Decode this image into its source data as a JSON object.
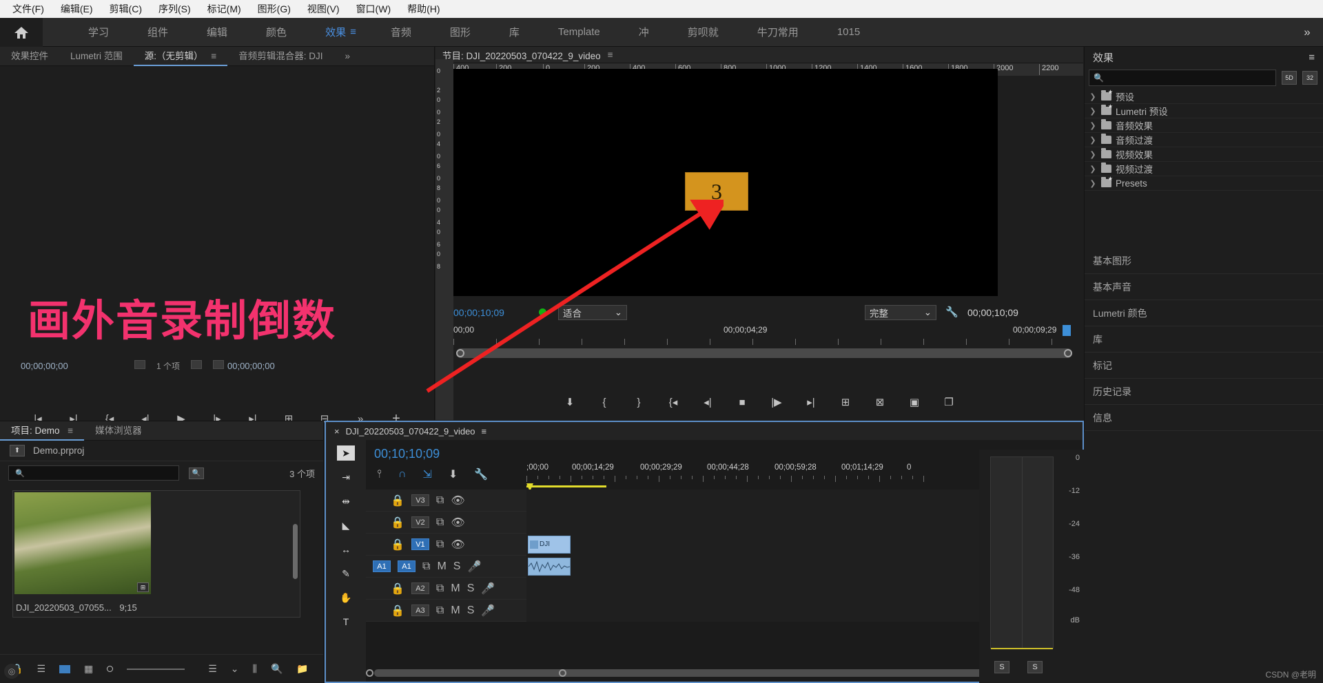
{
  "menubar": [
    {
      "label": "文件(F)"
    },
    {
      "label": "编辑(E)"
    },
    {
      "label": "剪辑(C)"
    },
    {
      "label": "序列(S)"
    },
    {
      "label": "标记(M)"
    },
    {
      "label": "图形(G)"
    },
    {
      "label": "视图(V)"
    },
    {
      "label": "窗口(W)"
    },
    {
      "label": "帮助(H)"
    }
  ],
  "workspace": {
    "home_icon": "home-icon",
    "tabs": [
      {
        "label": "学习",
        "active": false
      },
      {
        "label": "组件",
        "active": false
      },
      {
        "label": "编辑",
        "active": false
      },
      {
        "label": "颜色",
        "active": false
      },
      {
        "label": "效果",
        "active": true
      },
      {
        "label": "音频",
        "active": false
      },
      {
        "label": "图形",
        "active": false
      },
      {
        "label": "库",
        "active": false
      },
      {
        "label": "Template",
        "active": false
      },
      {
        "label": "冲",
        "active": false
      },
      {
        "label": "剪呗就",
        "active": false
      },
      {
        "label": "牛刀常用",
        "active": false
      },
      {
        "label": "1015",
        "active": false
      }
    ],
    "burger": "≡",
    "more": "»",
    "accent": "#4a8fe0"
  },
  "source_panel": {
    "tabs": [
      {
        "label": "效果控件",
        "active": false
      },
      {
        "label": "Lumetri 范围",
        "active": false
      },
      {
        "label": "源:（无剪辑）",
        "active": true
      },
      {
        "label": "音频剪辑混合器: DJI",
        "active": false
      }
    ],
    "overflow": "»",
    "timecode_left": "00;00;00;00",
    "timecode_right": "00;00;00;00",
    "fit_label": "1 个项",
    "toolbar_icons": [
      "prev-marker-icon",
      "next-marker-icon",
      "mark-in-icon",
      "step-back-icon",
      "play-icon",
      "step-forward-icon",
      "go-to-out-icon",
      "insert-icon",
      "overwrite-icon",
      "more-icon",
      "add-icon"
    ]
  },
  "program_panel": {
    "title": "节目: DJI_20220503_070422_9_video",
    "burger": "≡",
    "ruler_labels": [
      "400",
      "200",
      "0",
      "200",
      "400",
      "600",
      "800",
      "1000",
      "1200",
      "1400",
      "1600",
      "1800",
      "2000",
      "2200"
    ],
    "vertical_labels": [
      "0",
      "2",
      "0",
      "0",
      "2",
      "0",
      "4",
      "0",
      "6",
      "0",
      "8",
      "0",
      "0",
      "4",
      "0",
      "6",
      "0",
      "8"
    ],
    "counter_value": "3",
    "counter_bg": "#d4941e",
    "playhead_timecode": "00;00;10;09",
    "fit_select": "适合",
    "quality_select": "完整",
    "duration_timecode": "00;00;10;09",
    "scrub_labels": [
      "00;00",
      "00;00;04;29",
      "00;00;09;29"
    ],
    "toolbar_icons": [
      "add-marker-icon",
      "mark-in-icon",
      "mark-out-icon",
      "go-to-in-icon",
      "step-back-icon",
      "stop-icon",
      "play-icon",
      "go-to-out-icon",
      "lift-icon",
      "extract-icon",
      "export-frame-icon",
      "comparison-view-icon"
    ]
  },
  "effects_panel": {
    "title": "效果",
    "burger": "≡",
    "search_placeholder": "",
    "search_value": "",
    "btn_accel": "32",
    "btn_speed": "5D",
    "rows": [
      {
        "label": "预设",
        "icon": "folder-star-icon"
      },
      {
        "label": "Lumetri 预设",
        "icon": "folder-star-icon"
      },
      {
        "label": "音频效果",
        "icon": "folder-icon"
      },
      {
        "label": "音频过渡",
        "icon": "folder-icon"
      },
      {
        "label": "视频效果",
        "icon": "folder-icon"
      },
      {
        "label": "视频过渡",
        "icon": "folder-icon"
      },
      {
        "label": "Presets",
        "icon": "folder-star-icon"
      }
    ],
    "footer_icons": [
      "new-folder-icon",
      "delete-icon"
    ]
  },
  "stacked_panels": {
    "rows": [
      {
        "label": "基本图形"
      },
      {
        "label": "基本声音"
      },
      {
        "label": "Lumetri 颜色"
      },
      {
        "label": "库"
      },
      {
        "label": "标记"
      },
      {
        "label": "历史记录"
      },
      {
        "label": "信息"
      }
    ]
  },
  "project_panel": {
    "tabs": [
      {
        "label": "项目: Demo",
        "active": true
      },
      {
        "label": "媒体浏览器",
        "active": false
      }
    ],
    "burger": "≡",
    "project_file": "Demo.prproj",
    "search_value": "",
    "item_count": "3 个项",
    "item": {
      "name": "DJI_20220503_07055...",
      "duration": "9;15",
      "badge": "⊞"
    },
    "bottom_icons": [
      "lock-icon",
      "list-view-icon",
      "icon-view-icon",
      "freeform-view-icon",
      "zoom-slider",
      "sort-icon",
      "chevron-down-icon",
      "automate-icon",
      "find-icon",
      "new-bin-icon"
    ]
  },
  "timeline_panel": {
    "close": "×",
    "title": "DJI_20220503_070422_9_video",
    "burger": "≡",
    "playhead_timecode": "00;10;10;09",
    "tool_icons": [
      "track-select-icon",
      "snap-icon",
      "linked-selection-icon",
      "marker-icon",
      "settings-icon"
    ],
    "toolbar": [
      "selection-tool",
      "track-select-forward-tool",
      "ripple-edit-tool",
      "razor-tool",
      "slip-tool",
      "pen-tool",
      "hand-tool",
      "type-tool"
    ],
    "ruler_labels": [
      ";00;00",
      "00;00;14;29",
      "00;00;29;29",
      "00;00;44;28",
      "00;00;59;28",
      "00;01;14;29",
      "0"
    ],
    "tracks": [
      {
        "name": "V3",
        "type": "video",
        "locked": false,
        "targeted": false,
        "clip": null
      },
      {
        "name": "V2",
        "type": "video",
        "locked": false,
        "targeted": false,
        "clip": null
      },
      {
        "name": "V1",
        "type": "video",
        "locked": false,
        "targeted": true,
        "clip": {
          "label": "DJI",
          "kind": "video"
        }
      },
      {
        "name": "A1",
        "type": "audio",
        "locked": false,
        "targeted": true,
        "source": "A1",
        "clip": {
          "label": "",
          "kind": "audio"
        }
      },
      {
        "name": "A2",
        "type": "audio",
        "locked": false,
        "targeted": false,
        "clip": null
      },
      {
        "name": "A3",
        "type": "audio",
        "locked": false,
        "targeted": false,
        "clip": null
      }
    ],
    "audio_controls": {
      "mute": "M",
      "solo": "S",
      "mic": "mic-icon"
    }
  },
  "audio_meter": {
    "scale": [
      "0",
      "-12",
      "-24",
      "-36",
      "-48",
      "dB"
    ],
    "buttons": [
      "S",
      "S"
    ]
  },
  "annotation": {
    "text": "画外音录制倒数",
    "color": "#f3326e",
    "arrow_color": "#ee2222"
  },
  "watermark": "CSDN @老明"
}
